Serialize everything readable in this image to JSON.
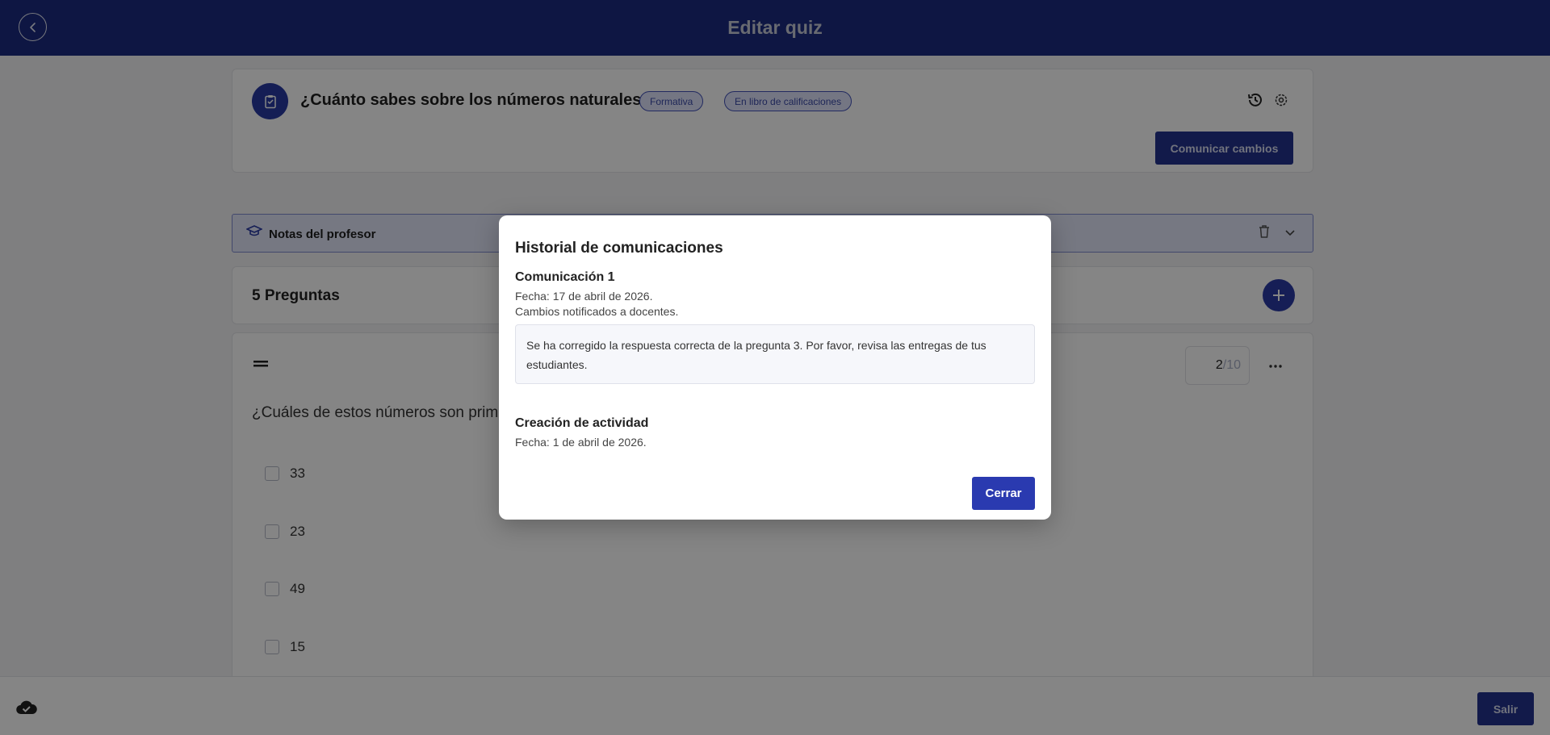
{
  "header": {
    "title": "Editar quiz"
  },
  "quiz": {
    "title": "¿Cuánto sabes sobre los números naturales?",
    "tags": [
      "Formativa",
      "En libro de calificaciones"
    ],
    "communicate_label": "Comunicar cambios"
  },
  "notes": {
    "label": "Notas del profesor"
  },
  "questions": {
    "count_label": "5 Preguntas"
  },
  "question": {
    "points_value": "2",
    "points_max": "/10",
    "text": "¿Cuáles de estos números son primos?",
    "options": [
      "33",
      "23",
      "49",
      "15"
    ]
  },
  "footer": {
    "exit_label": "Salir"
  },
  "modal": {
    "title": "Historial de comunicaciones",
    "communication": {
      "title": "Comunicación 1",
      "date": "Fecha: 17 de abril de 2026.",
      "note": "Cambios notificados a docentes.",
      "message": "Se ha corregido la respuesta correcta de la pregunta 3. Por favor, revisa las entregas de tus estudiantes."
    },
    "creation": {
      "title": "Creación de actividad",
      "date": "Fecha: 1 de abril de 2026."
    },
    "close_label": "Cerrar"
  },
  "colors": {
    "primary": "#1b2b80",
    "button": "#2a3ab0",
    "pill_bg": "#dfe3fb"
  }
}
